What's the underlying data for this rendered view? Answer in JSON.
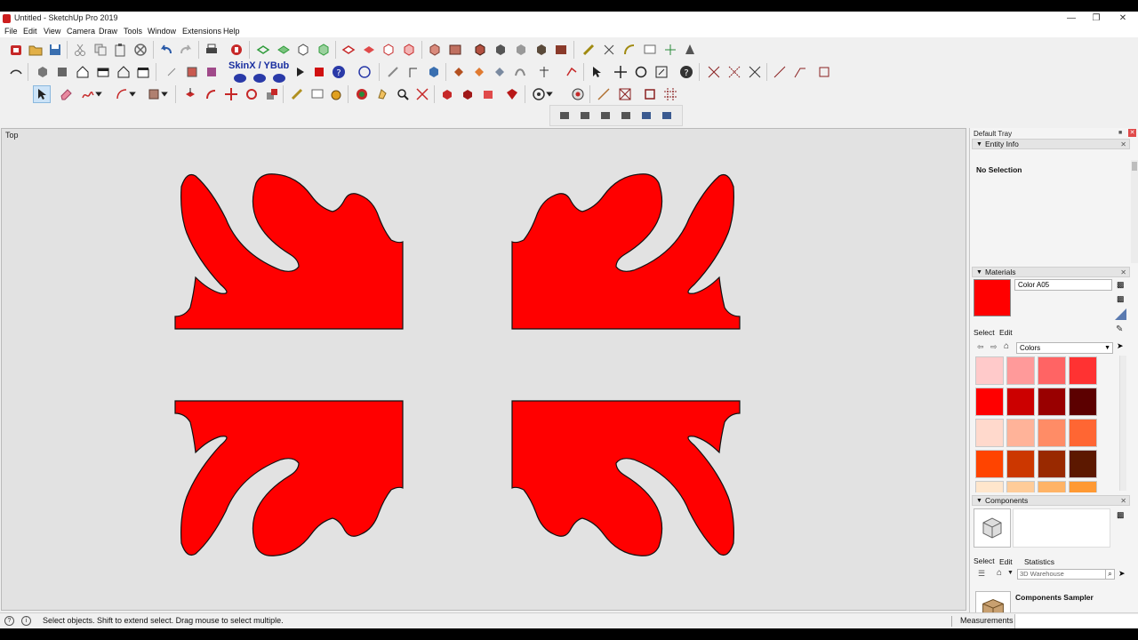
{
  "window": {
    "title": "Untitled - SketchUp Pro 2019"
  },
  "menu": [
    "File",
    "Edit",
    "View",
    "Camera",
    "Draw",
    "Tools",
    "Window",
    "Extensions",
    "Help"
  ],
  "toolbar": {
    "skin_label": "SkinX / YBub"
  },
  "viewport": {
    "scene_label": "Top",
    "shape_color": "#ff0000"
  },
  "tray": {
    "title": "Default Tray",
    "entity_info": {
      "header": "Entity Info",
      "selection": "No Selection"
    },
    "materials": {
      "header": "Materials",
      "current_name": "Color A05",
      "current_color": "#ff0000",
      "tab_select": "Select",
      "tab_edit": "Edit",
      "library": "Colors",
      "swatches": [
        "#ffcaca",
        "#ff9a9a",
        "#ff6464",
        "#ff3232",
        "#ff0000",
        "#cc0000",
        "#990000",
        "#5c0000",
        "#ffd9cc",
        "#ffb399",
        "#ff8c66",
        "#ff6633",
        "#ff4400",
        "#cc3700",
        "#992900",
        "#5c1800",
        "#ffe6cc",
        "#ffcc99",
        "#ffb366",
        "#ff9933"
      ]
    },
    "components": {
      "header": "Components",
      "tab_select": "Select",
      "tab_edit": "Edit",
      "tab_statistics": "Statistics",
      "search_placeholder": "3D Warehouse",
      "sampler_title": "Components Sampler"
    }
  },
  "status": {
    "hint": "Select objects. Shift to extend select. Drag mouse to select multiple.",
    "measurements_label": "Measurements"
  }
}
